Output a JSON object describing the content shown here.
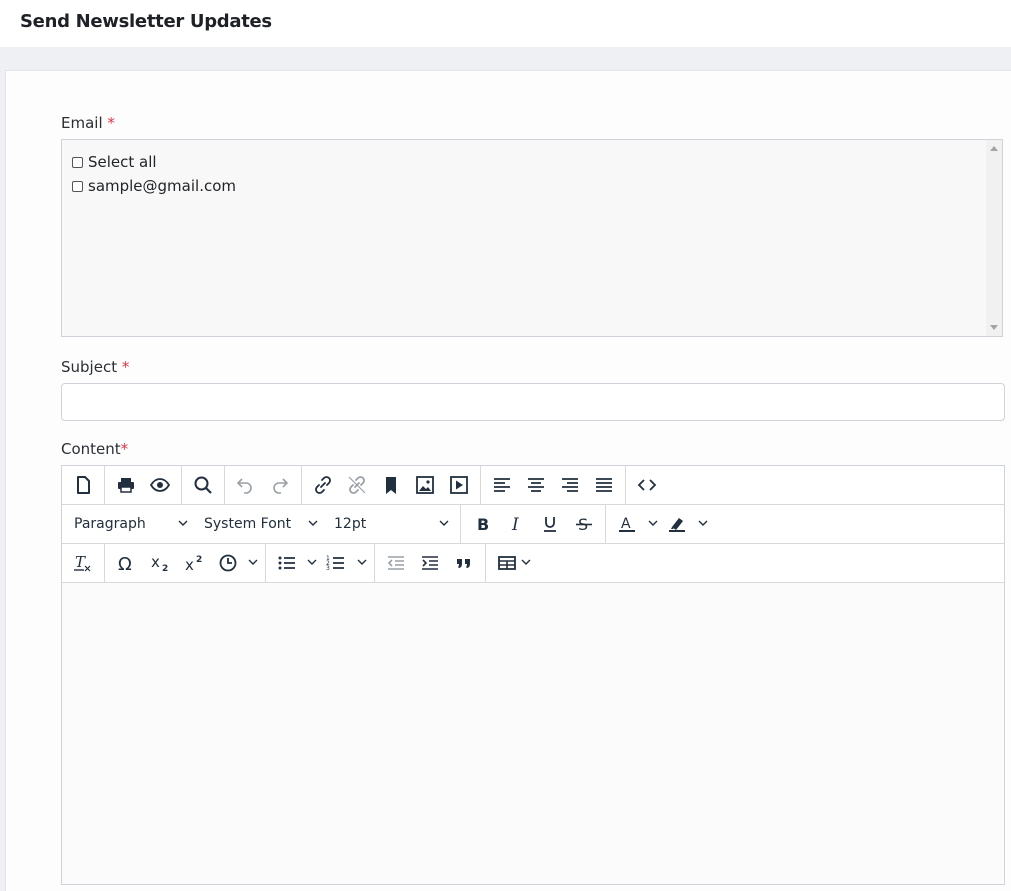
{
  "page": {
    "title": "Send Newsletter Updates"
  },
  "form": {
    "email": {
      "label": "Email",
      "required_mark": "*",
      "options": [
        "Select all",
        "sample@gmail.com"
      ]
    },
    "subject": {
      "label": "Subject",
      "required_mark": "*",
      "value": ""
    },
    "content": {
      "label": "Content",
      "required_mark": "*"
    }
  },
  "editor": {
    "block_format": "Paragraph",
    "font_family": "System Font",
    "font_size": "12pt",
    "icon_color": "#222f3e"
  }
}
